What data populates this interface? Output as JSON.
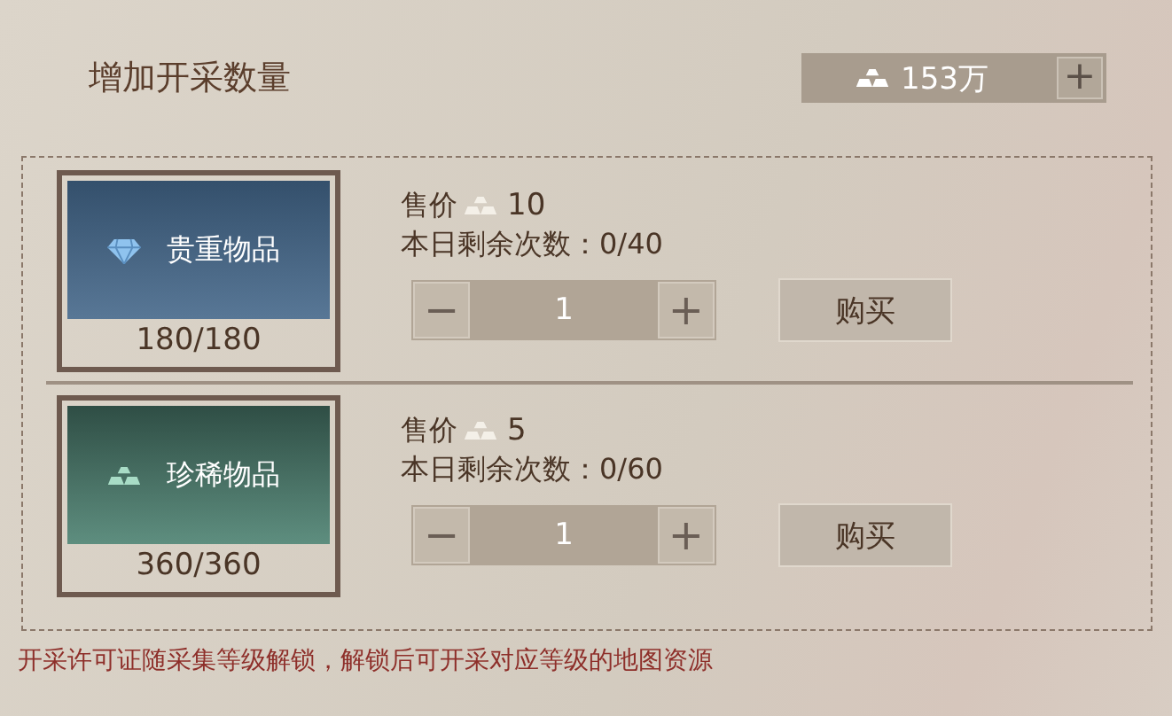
{
  "title": "增加开采数量",
  "currency": {
    "amount": "153万",
    "add_label": "+"
  },
  "items": [
    {
      "kind": "precious",
      "name": "贵重物品",
      "stock": "180/180",
      "price_label": "售价",
      "price": "10",
      "remaining": "本日剩余次数：0/40",
      "minus": "−",
      "quantity": "1",
      "plus": "+",
      "buy": "购买"
    },
    {
      "kind": "rare",
      "name": "珍稀物品",
      "stock": "360/360",
      "price_label": "售价",
      "price": "5",
      "remaining": "本日剩余次数：0/60",
      "minus": "−",
      "quantity": "1",
      "plus": "+",
      "buy": "购买"
    }
  ],
  "footer": "开采许可证随采集等级解锁，解锁后可开采对应等级的地图资源"
}
